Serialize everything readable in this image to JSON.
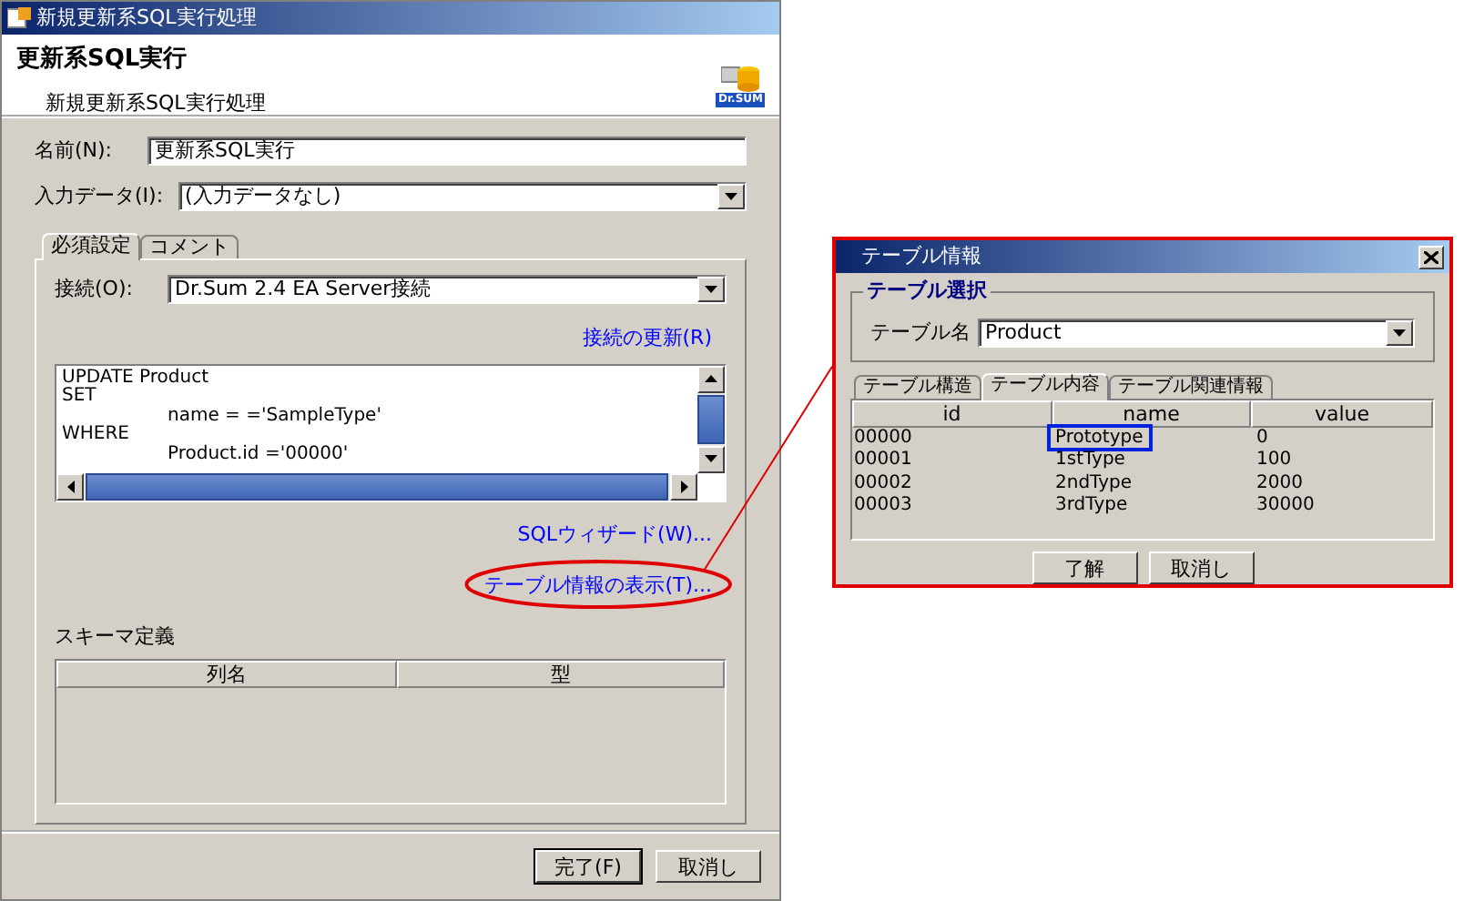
{
  "main_dialog": {
    "window": {
      "title": "新規更新系SQL実行処理"
    },
    "header": {
      "title": "更新系SQL実行",
      "subtitle": "新規更新系SQL実行処理",
      "logo_text": "Dr.SUM"
    },
    "fields": [
      {
        "label": "名前(N):",
        "kind": "text",
        "value": "更新系SQL実行"
      },
      {
        "label": "入力データ(I):",
        "kind": "select",
        "value": "(入力データなし)"
      }
    ],
    "tabs": [
      {
        "label": "必須設定",
        "selected": true
      },
      {
        "label": "コメント",
        "selected": false
      }
    ],
    "connection": {
      "label": "接続(O):",
      "value": "Dr.Sum 2.4 EA Server接続"
    },
    "refresh_link": "接続の更新(R)",
    "sql_lines": [
      {
        "text": "UPDATE Product",
        "kind": "plain"
      },
      {
        "text": "SET",
        "kind": "plain"
      },
      {
        "text": "name = ='SampleType'",
        "kind": "indented"
      },
      {
        "text": "WHERE",
        "kind": "plain"
      },
      {
        "text": "Product.id ='00000'",
        "kind": "indented"
      }
    ],
    "links": [
      {
        "label": "SQLウィザード(W)...",
        "circled": false
      },
      {
        "label": "テーブル情報の表示(T)...",
        "circled": true
      }
    ],
    "schema": {
      "label": "スキーマ定義",
      "columns": [
        "列名",
        "型"
      ]
    },
    "buttons": [
      {
        "label": "完了(F)",
        "default": true
      },
      {
        "label": "取消し",
        "default": false
      }
    ]
  },
  "table_dialog": {
    "window": {
      "title": "テーブル情報"
    },
    "group_title": "テーブル選択",
    "table_field": {
      "label": "テーブル名",
      "value": "Product"
    },
    "tabs": [
      {
        "label": "テーブル構造",
        "selected": false
      },
      {
        "label": "テーブル内容",
        "selected": true
      },
      {
        "label": "テーブル関連情報",
        "selected": false
      }
    ],
    "columns": [
      "id",
      "name",
      "value"
    ],
    "rows": [
      {
        "cells": [
          "00000",
          "Prototype",
          "0"
        ],
        "highlighted": true
      },
      {
        "cells": [
          "00001",
          "1stType",
          "100"
        ],
        "highlighted": false
      },
      {
        "cells": [
          "00002",
          "2ndType",
          "2000"
        ],
        "highlighted": false
      },
      {
        "cells": [
          "00003",
          "3rdType",
          "30000"
        ],
        "highlighted": false
      }
    ],
    "buttons": [
      "了解",
      "取消し"
    ]
  }
}
